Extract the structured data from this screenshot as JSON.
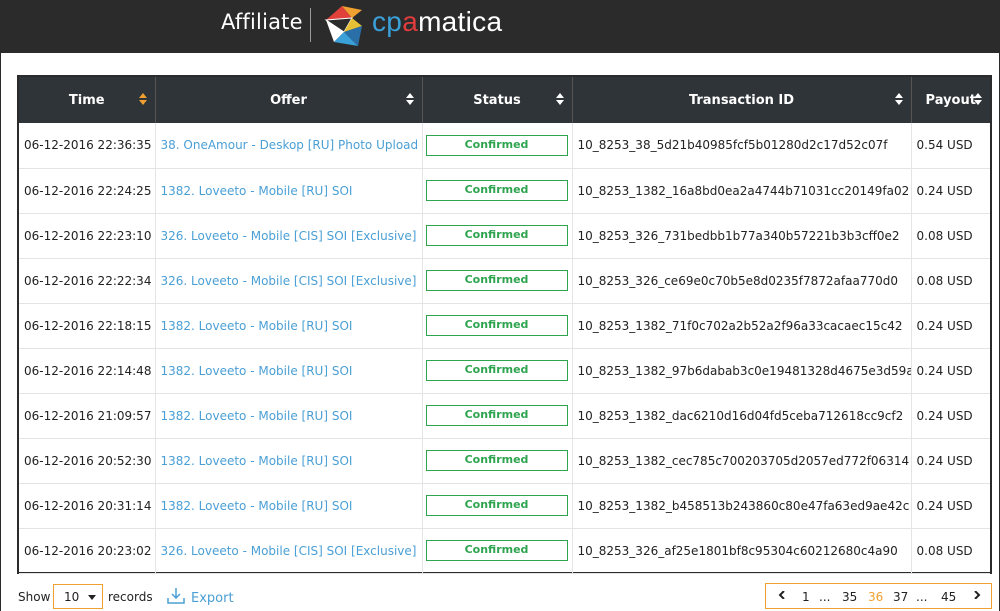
{
  "header": {
    "section_title": "Affiliate",
    "brand_part1": "cp",
    "brand_part2": "a",
    "brand_part3": "matica"
  },
  "table": {
    "columns": [
      "Time",
      "Offer",
      "Status",
      "Transaction ID",
      "Payout"
    ],
    "rows": [
      {
        "time": "06-12-2016 22:36:35",
        "offer": "38. OneAmour - Deskop [RU] Photo Upload",
        "status": "Confirmed",
        "txid": "10_8253_38_5d21b40985fcf5b01280d2c17d52c07f",
        "payout": "0.54 USD"
      },
      {
        "time": "06-12-2016 22:24:25",
        "offer": "1382. Loveeto - Mobile [RU] SOI",
        "status": "Confirmed",
        "txid": "10_8253_1382_16a8bd0ea2a4744b71031cc20149fa02",
        "payout": "0.24 USD"
      },
      {
        "time": "06-12-2016 22:23:10",
        "offer": "326. Loveeto - Mobile [CIS] SOI [Exclusive]",
        "status": "Confirmed",
        "txid": "10_8253_326_731bedbb1b77a340b57221b3b3cff0e2",
        "payout": "0.08 USD"
      },
      {
        "time": "06-12-2016 22:22:34",
        "offer": "326. Loveeto - Mobile [CIS] SOI [Exclusive]",
        "status": "Confirmed",
        "txid": "10_8253_326_ce69e0c70b5e8d0235f7872afaa770d0",
        "payout": "0.08 USD"
      },
      {
        "time": "06-12-2016 22:18:15",
        "offer": "1382. Loveeto - Mobile [RU] SOI",
        "status": "Confirmed",
        "txid": "10_8253_1382_71f0c702a2b52a2f96a33cacaec15c42",
        "payout": "0.24 USD"
      },
      {
        "time": "06-12-2016 22:14:48",
        "offer": "1382. Loveeto - Mobile [RU] SOI",
        "status": "Confirmed",
        "txid": "10_8253_1382_97b6dabab3c0e19481328d4675e3d59a",
        "payout": "0.24 USD"
      },
      {
        "time": "06-12-2016 21:09:57",
        "offer": "1382. Loveeto - Mobile [RU] SOI",
        "status": "Confirmed",
        "txid": "10_8253_1382_dac6210d16d04fd5ceba712618cc9cf2",
        "payout": "0.24 USD"
      },
      {
        "time": "06-12-2016 20:52:30",
        "offer": "1382. Loveeto - Mobile [RU] SOI",
        "status": "Confirmed",
        "txid": "10_8253_1382_cec785c700203705d2057ed772f06314",
        "payout": "0.24 USD"
      },
      {
        "time": "06-12-2016 20:31:14",
        "offer": "1382. Loveeto - Mobile [RU] SOI",
        "status": "Confirmed",
        "txid": "10_8253_1382_b458513b243860c80e47fa63ed9ae42c",
        "payout": "0.24 USD"
      },
      {
        "time": "06-12-2016 20:23:02",
        "offer": "326. Loveeto - Mobile [CIS] SOI [Exclusive]",
        "status": "Confirmed",
        "txid": "10_8253_326_af25e1801bf8c95304c60212680c4a90",
        "payout": "0.08 USD"
      }
    ]
  },
  "footer": {
    "show_label": "Show",
    "page_size": "10",
    "records_label": "records",
    "export_label": "Export",
    "pagination": {
      "first": "1",
      "ellipsis1": "...",
      "prev_page": "35",
      "current_page": "36",
      "next_page": "37",
      "ellipsis2": "...",
      "last": "45"
    }
  },
  "colors": {
    "header_bg": "#2b2b2b",
    "table_header_bg": "#2f3438",
    "link": "#4a9fd5",
    "confirmed": "#2ea44f",
    "accent": "#f0a030"
  }
}
